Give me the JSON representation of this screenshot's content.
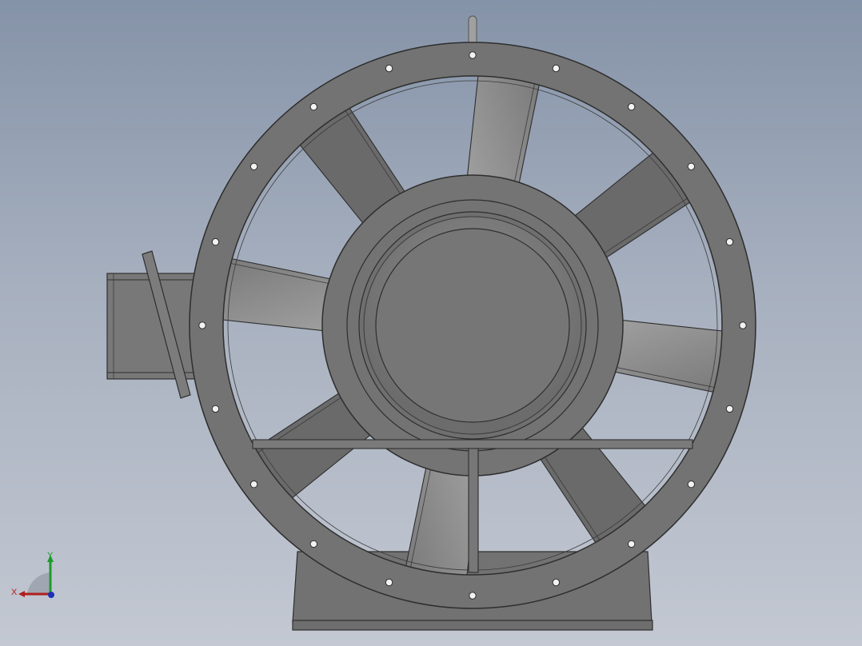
{
  "viewport": {
    "background_top": "#8593a8",
    "background_bottom": "#c3c8d2"
  },
  "model": {
    "part": "axial-fan",
    "blade_count": 8,
    "flange_bolt_hole_count": 20,
    "colors": {
      "body": "#737373",
      "edge": "#2e2e2e",
      "blade_light": "#9a9a9a",
      "blade_dark": "#626262",
      "hub_face": "#767676"
    }
  },
  "triad": {
    "x_label": "X",
    "y_label": "Y",
    "x_color": "#b01e1e",
    "y_color": "#1e9a2a",
    "z_color": "#1f2fb5"
  }
}
